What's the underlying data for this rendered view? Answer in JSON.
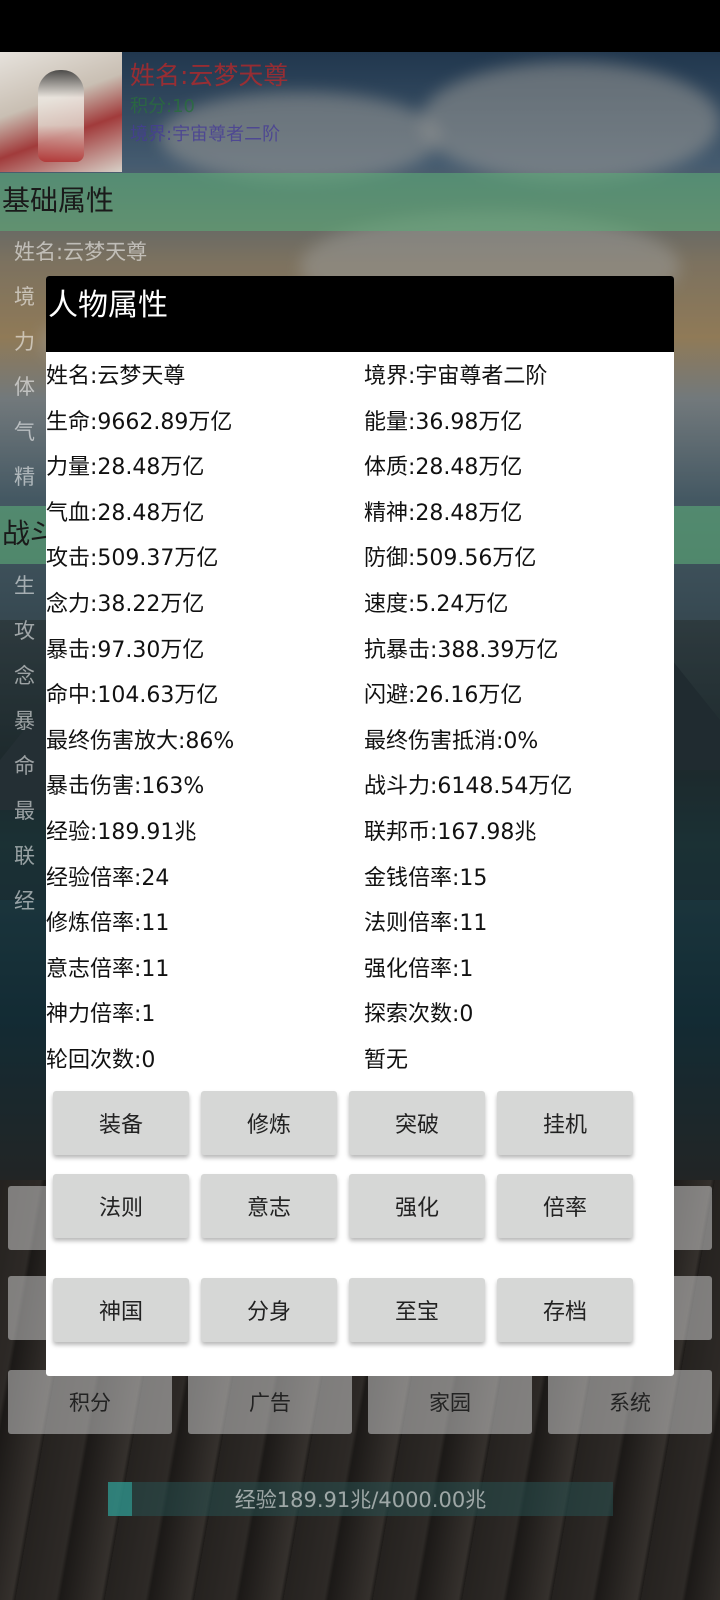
{
  "header": {
    "name": "姓名:云梦天尊",
    "score": "积分:10",
    "realm": "境界:宇宙尊者二阶"
  },
  "background": {
    "section_basic": "基础属性",
    "section_battle": "战斗",
    "basic_lines": [
      "姓名:云梦天尊",
      "境",
      "力",
      "体",
      "气",
      "精"
    ],
    "battle_lines": [
      "生",
      "攻",
      "念",
      "暴",
      "命",
      "最",
      "联",
      "经"
    ],
    "buttons": [
      "积分",
      "广告",
      "家园",
      "系统"
    ],
    "exp_text": "经验189.91兆/4000.00兆",
    "exp_progress": 0.047
  },
  "dialog": {
    "title": "人物属性",
    "attributes": [
      [
        "姓名:云梦天尊",
        "境界:宇宙尊者二阶"
      ],
      [
        "生命:9662.89万亿",
        "能量:36.98万亿"
      ],
      [
        "力量:28.48万亿",
        "体质:28.48万亿"
      ],
      [
        "气血:28.48万亿",
        "精神:28.48万亿"
      ],
      [
        "攻击:509.37万亿",
        "防御:509.56万亿"
      ],
      [
        "念力:38.22万亿",
        "速度:5.24万亿"
      ],
      [
        "暴击:97.30万亿",
        "抗暴击:388.39万亿"
      ],
      [
        "命中:104.63万亿",
        "闪避:26.16万亿"
      ],
      [
        "最终伤害放大:86%",
        "最终伤害抵消:0%"
      ],
      [
        "暴击伤害:163%",
        "战斗力:6148.54万亿"
      ],
      [
        "经验:189.91兆",
        "联邦币:167.98兆"
      ],
      [
        "经验倍率:24",
        "金钱倍率:15"
      ],
      [
        "修炼倍率:11",
        "法则倍率:11"
      ],
      [
        "意志倍率:11",
        "强化倍率:1"
      ],
      [
        "神力倍率:1",
        "探索次数:0"
      ],
      [
        "轮回次数:0",
        "暂无"
      ]
    ],
    "buttons": [
      [
        "装备",
        "修炼",
        "突破",
        "挂机"
      ],
      [
        "法则",
        "意志",
        "强化",
        "倍率"
      ],
      [
        "神国",
        "分身",
        "至宝",
        "存档"
      ]
    ]
  }
}
